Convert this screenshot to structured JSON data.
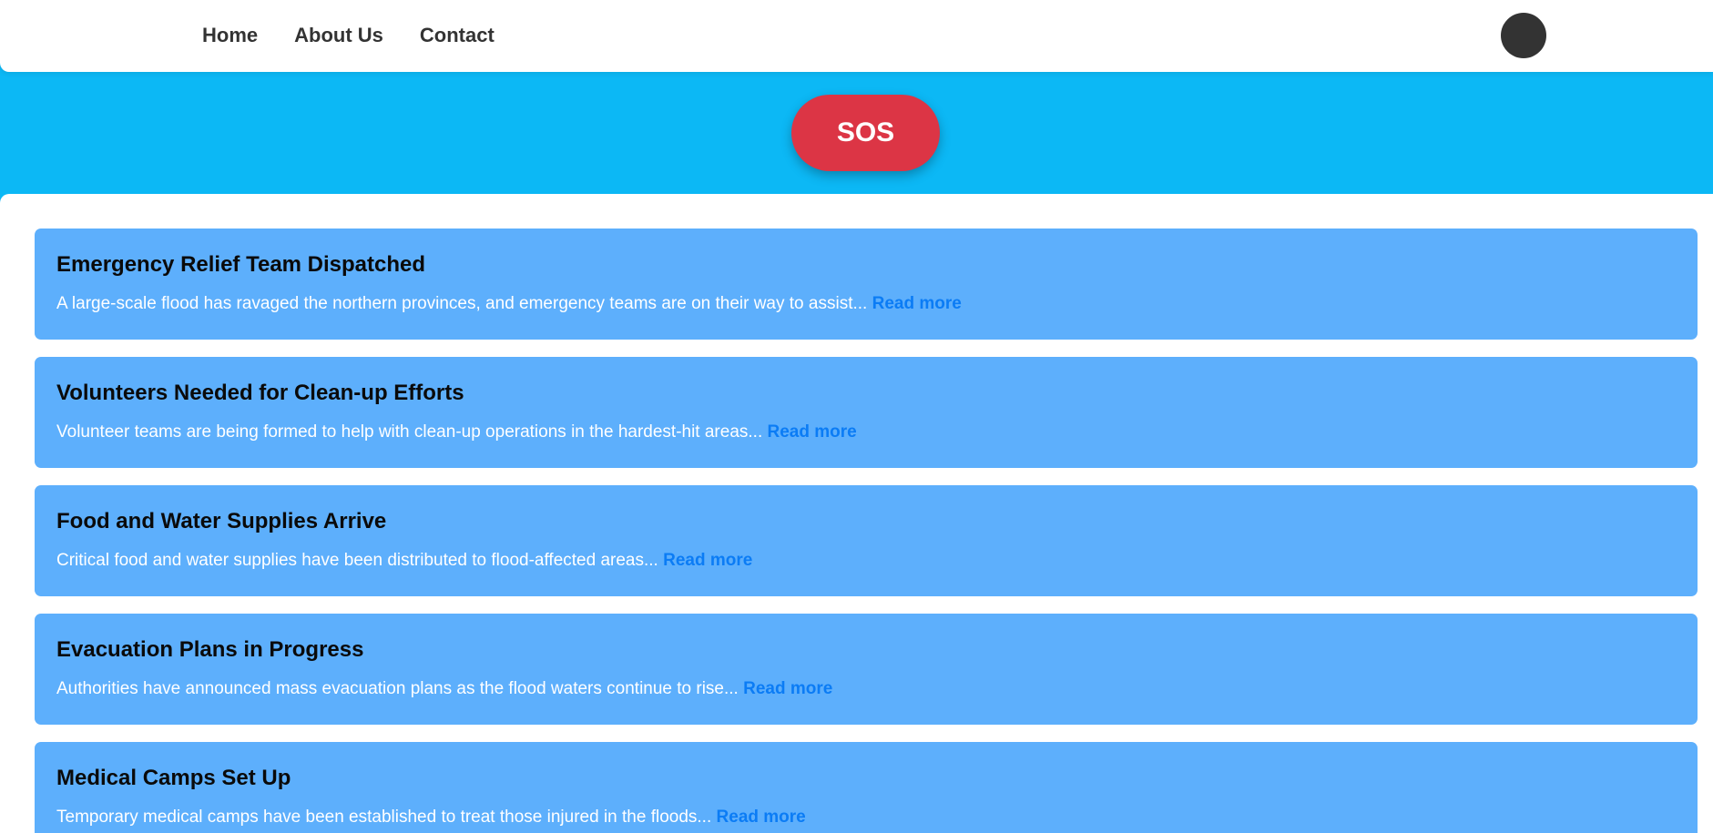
{
  "nav": {
    "links": [
      "Home",
      "About Us",
      "Contact"
    ]
  },
  "hero": {
    "sos_label": "SOS"
  },
  "news": [
    {
      "title": "Emergency Relief Team Dispatched",
      "summary": "A large-scale flood has ravaged the northern provinces, and emergency teams are on their way to assist...",
      "link": "Read more"
    },
    {
      "title": "Volunteers Needed for Clean-up Efforts",
      "summary": "Volunteer teams are being formed to help with clean-up operations in the hardest-hit areas...",
      "link": "Read more"
    },
    {
      "title": "Food and Water Supplies Arrive",
      "summary": "Critical food and water supplies have been distributed to flood-affected areas...",
      "link": "Read more"
    },
    {
      "title": "Evacuation Plans in Progress",
      "summary": "Authorities have announced mass evacuation plans as the flood waters continue to rise...",
      "link": "Read more"
    },
    {
      "title": "Medical Camps Set Up",
      "summary": "Temporary medical camps have been established to treat those injured in the floods...",
      "link": "Read more"
    }
  ],
  "colors": {
    "hero_background": "#0cb8f5",
    "card_background": "#5daffc",
    "sos_button": "#dc3545",
    "link": "#0b7cf5",
    "avatar": "#333333"
  }
}
